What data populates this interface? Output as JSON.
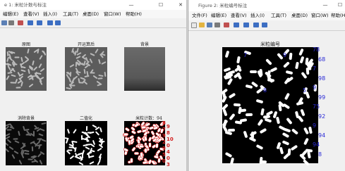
{
  "window1": {
    "title": "e 1: 米粒计数与标注",
    "menu": [
      "编辑(E)",
      "查看(V)",
      "插入(I)",
      "工具(T)",
      "桌面(D)",
      "窗口(W)",
      "帮助(H)"
    ],
    "controls": [
      "—",
      "☐",
      "✕"
    ],
    "subplots": [
      {
        "title": "原图",
        "style": "gray"
      },
      {
        "title": "开运算后",
        "style": "gray"
      },
      {
        "title": "背景",
        "style": "bg"
      },
      {
        "title": "消除背景",
        "style": "dark"
      },
      {
        "title": "二值化",
        "style": "binary"
      },
      {
        "title": "米粒计数：94",
        "style": "count"
      }
    ],
    "count_labels": [
      "8",
      "9",
      "7",
      "8",
      "9",
      "10",
      "2",
      "0",
      "9",
      "4",
      "5",
      "0",
      "0",
      "3"
    ]
  },
  "window2": {
    "title": "Figure 2: 米粒编号标注",
    "menu": [
      "文件(F)",
      "编辑(E)",
      "查看(V)",
      "插入(I)",
      "工具(T)",
      "桌面(D)",
      "窗口(W)",
      "帮助(H)"
    ],
    "controls": [
      "—",
      "☐"
    ],
    "plot_title": "米粒编号",
    "right_labels": [
      "78",
      "68",
      "7",
      "98",
      "9",
      "99",
      "75",
      "92",
      "9",
      "94",
      "94",
      "8"
    ],
    "top_labels": [
      "7",
      "8",
      "9",
      "5"
    ]
  },
  "colors": {
    "accent": "#2b2bd6",
    "red": "#d42020"
  }
}
